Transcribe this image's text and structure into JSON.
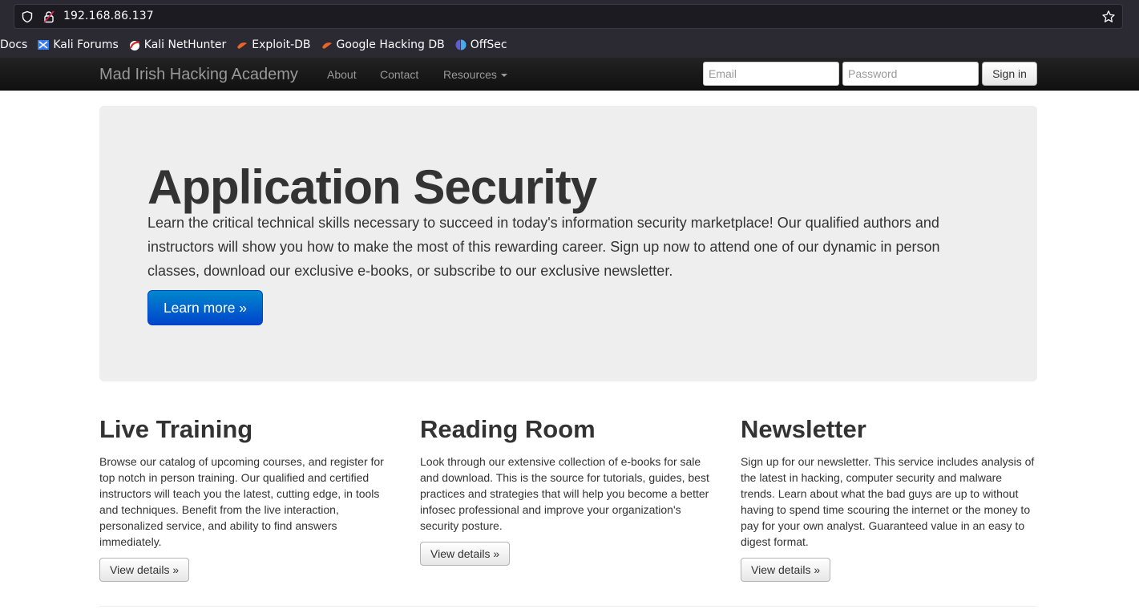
{
  "browser": {
    "url": "192.168.86.137",
    "bookmarks": [
      {
        "label": "Docs",
        "icon": "none"
      },
      {
        "label": "Kali Forums",
        "icon": "kali-forums-icon"
      },
      {
        "label": "Kali NetHunter",
        "icon": "nethunter-icon"
      },
      {
        "label": "Exploit-DB",
        "icon": "exploit-db-icon"
      },
      {
        "label": "Google Hacking DB",
        "icon": "ghdb-icon"
      },
      {
        "label": "OffSec",
        "icon": "offsec-icon"
      }
    ]
  },
  "navbar": {
    "brand": "Mad Irish Hacking Academy",
    "links": [
      {
        "label": "About"
      },
      {
        "label": "Contact"
      },
      {
        "label": "Resources"
      }
    ],
    "email_placeholder": "Email",
    "password_placeholder": "Password",
    "signin_label": "Sign in"
  },
  "hero": {
    "title": "Application Security",
    "text": "Learn the critical technical skills necessary to succeed in today's information security marketplace! Our qualified authors and instructors will show you how to make the most of this rewarding career. Sign up now to attend one of our dynamic in person classes, download our exclusive e-books, or subscribe to our exclusive newsletter.",
    "button_label": "Learn more »"
  },
  "columns": [
    {
      "title": "Live Training",
      "text": "Browse our catalog of upcoming courses, and register for top notch in person training. Our qualified and certified instructors will teach you the latest, cutting edge, in tools and techniques. Benefit from the live interaction, personalized service, and ability to find answers immediately.",
      "button_label": "View details »"
    },
    {
      "title": "Reading Room",
      "text": "Look through our extensive collection of e-books for sale and download. This is the source for tutorials, guides, best practices and strategies that will help you become a better infosec professional and improve your organization's security posture.",
      "button_label": "View details »"
    },
    {
      "title": "Newsletter",
      "text": "Sign up for our newsletter. This service includes analysis of the latest in hacking, computer security and malware trends. Learn about what the bad guys are up to without having to spend time scouring the internet or the money to pay for your own analyst. Guaranteed value in an easy to digest format.",
      "button_label": "View details »"
    }
  ],
  "colors": {
    "browser_bg": "#2b2a33",
    "navbar_bg": "#1b1b1b",
    "hero_bg": "#eeeeee",
    "primary": "#0066cc"
  }
}
